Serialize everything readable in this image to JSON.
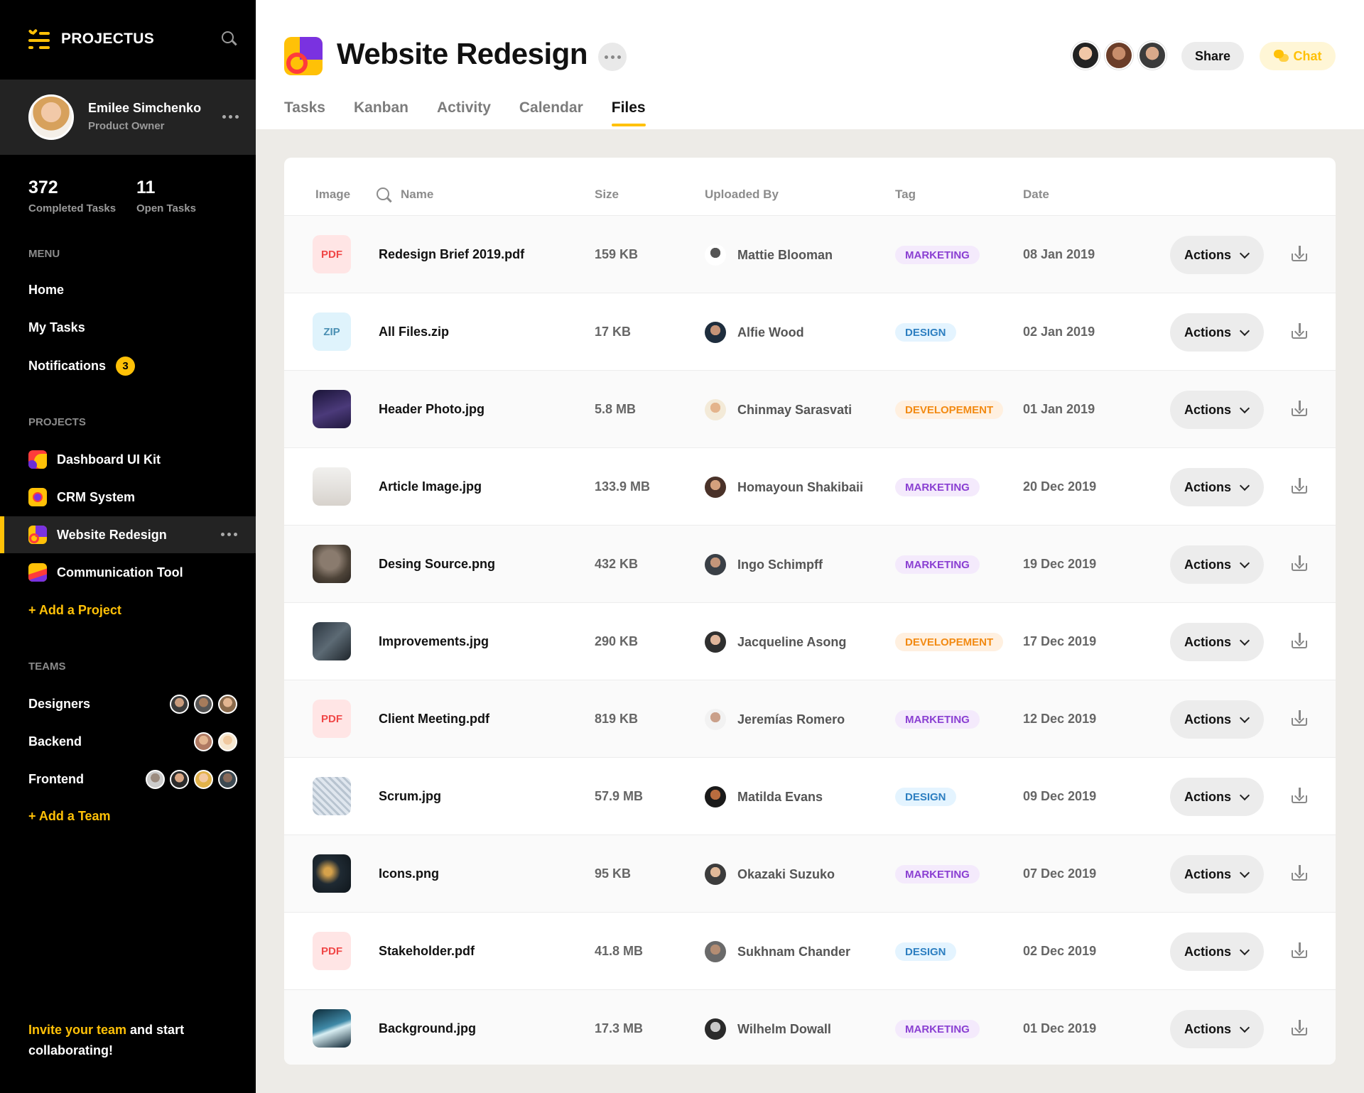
{
  "app": {
    "name": "PROJECTUS"
  },
  "user": {
    "name": "Emilee Simchenko",
    "role": "Product Owner"
  },
  "stats": [
    {
      "value": "372",
      "label": "Completed Tasks"
    },
    {
      "value": "11",
      "label": "Open Tasks"
    }
  ],
  "menu": {
    "title": "MENU",
    "items": [
      {
        "label": "Home"
      },
      {
        "label": "My Tasks"
      },
      {
        "label": "Notifications",
        "badge": "3"
      }
    ]
  },
  "projects": {
    "title": "PROJECTS",
    "items": [
      {
        "label": "Dashboard UI Kit"
      },
      {
        "label": "CRM System"
      },
      {
        "label": "Website Redesign",
        "active": true
      },
      {
        "label": "Communication Tool"
      }
    ],
    "add_label": "+ Add a Project"
  },
  "teams": {
    "title": "TEAMS",
    "items": [
      {
        "label": "Designers"
      },
      {
        "label": "Backend"
      },
      {
        "label": "Frontend"
      }
    ],
    "add_label": "+ Add a Team"
  },
  "invite": {
    "highlight": "Invite your team",
    "rest": " and start collaborating!"
  },
  "header": {
    "title": "Website Redesign",
    "share_label": "Share",
    "chat_label": "Chat",
    "tabs": [
      {
        "label": "Tasks"
      },
      {
        "label": "Kanban"
      },
      {
        "label": "Activity"
      },
      {
        "label": "Calendar"
      },
      {
        "label": "Files",
        "active": true
      }
    ]
  },
  "table": {
    "columns": {
      "image": "Image",
      "name": "Name",
      "size": "Size",
      "uploaded_by": "Uploaded By",
      "tag": "Tag",
      "date": "Date"
    },
    "action_label": "Actions",
    "rows": [
      {
        "thumb": "PDF",
        "name": "Redesign Brief 2019.pdf",
        "size": "159 KB",
        "user": "Mattie Blooman",
        "tag": "MARKETING",
        "date": "08 Jan 2019"
      },
      {
        "thumb": "ZIP",
        "name": "All Files.zip",
        "size": "17 KB",
        "user": "Alfie Wood",
        "tag": "DESIGN",
        "date": "02 Jan 2019"
      },
      {
        "thumb": "",
        "name": "Header Photo.jpg",
        "size": "5.8 MB",
        "user": "Chinmay Sarasvati",
        "tag": "DEVELOPEMENT",
        "date": "01 Jan 2019"
      },
      {
        "thumb": "",
        "name": "Article Image.jpg",
        "size": "133.9 MB",
        "user": "Homayoun Shakibaii",
        "tag": "MARKETING",
        "date": "20 Dec 2019"
      },
      {
        "thumb": "",
        "name": "Desing Source.png",
        "size": "432 KB",
        "user": "Ingo Schimpff",
        "tag": "MARKETING",
        "date": "19 Dec 2019"
      },
      {
        "thumb": "",
        "name": "Improvements.jpg",
        "size": "290 KB",
        "user": "Jacqueline Asong",
        "tag": "DEVELOPEMENT",
        "date": "17 Dec 2019"
      },
      {
        "thumb": "PDF",
        "name": "Client Meeting.pdf",
        "size": "819 KB",
        "user": "Jeremías Romero",
        "tag": "MARKETING",
        "date": "12 Dec 2019"
      },
      {
        "thumb": "",
        "name": "Scrum.jpg",
        "size": "57.9 MB",
        "user": "Matilda Evans",
        "tag": "DESIGN",
        "date": "09 Dec 2019"
      },
      {
        "thumb": "",
        "name": "Icons.png",
        "size": "95 KB",
        "user": "Okazaki Suzuko",
        "tag": "MARKETING",
        "date": "07 Dec 2019"
      },
      {
        "thumb": "PDF",
        "name": "Stakeholder.pdf",
        "size": "41.8 MB",
        "user": "Sukhnam Chander",
        "tag": "DESIGN",
        "date": "02 Dec 2019"
      },
      {
        "thumb": "",
        "name": "Background.jpg",
        "size": "17.3 MB",
        "user": "Wilhelm Dowall",
        "tag": "MARKETING",
        "date": "01 Dec 2019"
      }
    ]
  },
  "colors": {
    "accent": "#ffc107",
    "sidebar_bg": "#000000",
    "marketing": "#8a3fd2",
    "design": "#2d7fc1",
    "development": "#f28a12"
  }
}
